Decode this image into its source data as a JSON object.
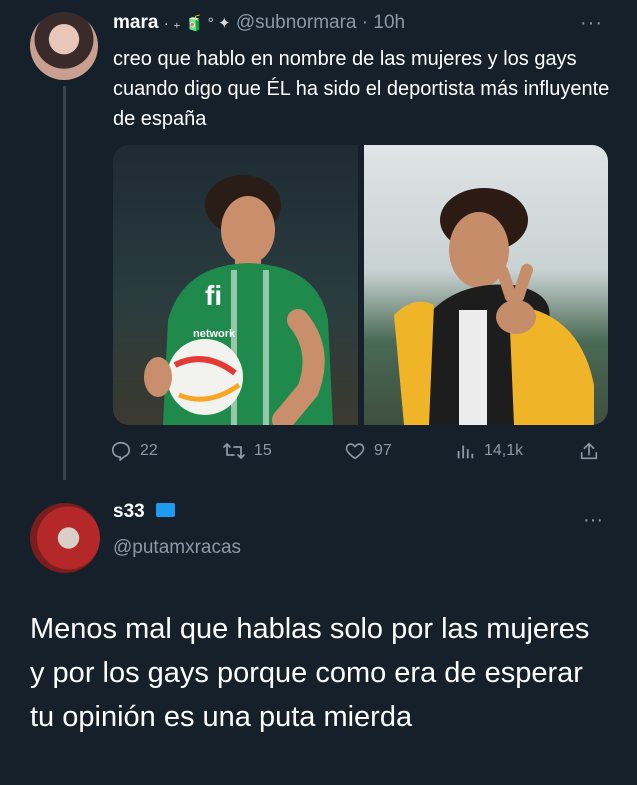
{
  "tweet": {
    "author_name": "mara",
    "author_decoration": "· ₊ 🧃 ° ✦",
    "handle": "@subnormara",
    "time": "· 10h",
    "more": "···",
    "text": "creo que hablo en nombre de las mujeres y los gays cuando digo que ÉL ha sido el deportista más influyente de españa",
    "media": [
      {
        "alt": "football-player-green-kit-photo"
      },
      {
        "alt": "young-man-yellow-jacket-peace-sign-photo"
      }
    ],
    "actions": {
      "replies": "22",
      "retweets": "15",
      "likes": "97",
      "views": "14,1k"
    }
  },
  "reply": {
    "author_name": "s33",
    "handle": "@putamxracas",
    "more": "···",
    "text": "Menos mal que hablas solo por las mujeres y por los gays porque como era de esperar tu opinión es una puta mierda"
  }
}
